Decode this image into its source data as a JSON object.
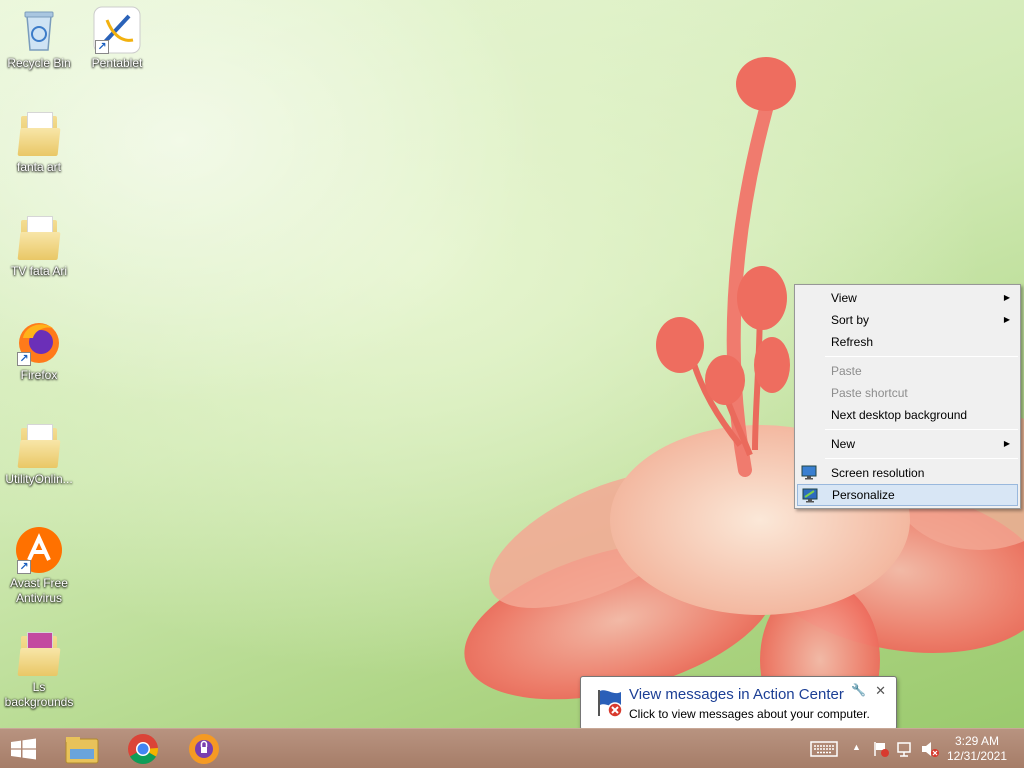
{
  "desktop": {
    "icons": [
      {
        "label": "Recycle Bin",
        "icon": "recycle-bin-icon"
      },
      {
        "label": "Pentablet",
        "icon": "pentablet-icon"
      },
      {
        "label": "fanta art",
        "icon": "folder-icon"
      },
      {
        "label": "TV fata Ari",
        "icon": "folder-icon"
      },
      {
        "label": "Firefox",
        "icon": "firefox-icon"
      },
      {
        "label": "UtilityOnlin...",
        "icon": "folder-icon"
      },
      {
        "label": "Avast Free Antivirus",
        "icon": "avast-icon"
      },
      {
        "label": "Ls backgrounds",
        "icon": "folder-icon"
      }
    ]
  },
  "context_menu": {
    "items": [
      {
        "label": "View",
        "submenu": true
      },
      {
        "label": "Sort by",
        "submenu": true
      },
      {
        "label": "Refresh"
      },
      {
        "label": "Paste",
        "disabled": true
      },
      {
        "label": "Paste shortcut",
        "disabled": true
      },
      {
        "label": "Next desktop background"
      },
      {
        "label": "New",
        "submenu": true
      },
      {
        "label": "Screen resolution",
        "icon": "monitor-icon"
      },
      {
        "label": "Personalize",
        "icon": "personalize-icon",
        "highlighted": true
      }
    ]
  },
  "balloon": {
    "title": "View messages in Action Center",
    "text": "Click to view messages about your computer.",
    "close": "✕",
    "pin": "🔧"
  },
  "taskbar": {
    "start": "windows-start-icon",
    "pinned": [
      "file-explorer-icon",
      "chrome-icon",
      "avast-secure-browser-icon"
    ],
    "tray": {
      "keyboard": "keyboard-icon",
      "chevron": "▲",
      "time": "3:29 AM",
      "date": "12/31/2021"
    }
  },
  "colors": {
    "taskbar": "#a67d68",
    "menu_highlight": "#d8e6f5",
    "balloon_title": "#1c3f95"
  }
}
